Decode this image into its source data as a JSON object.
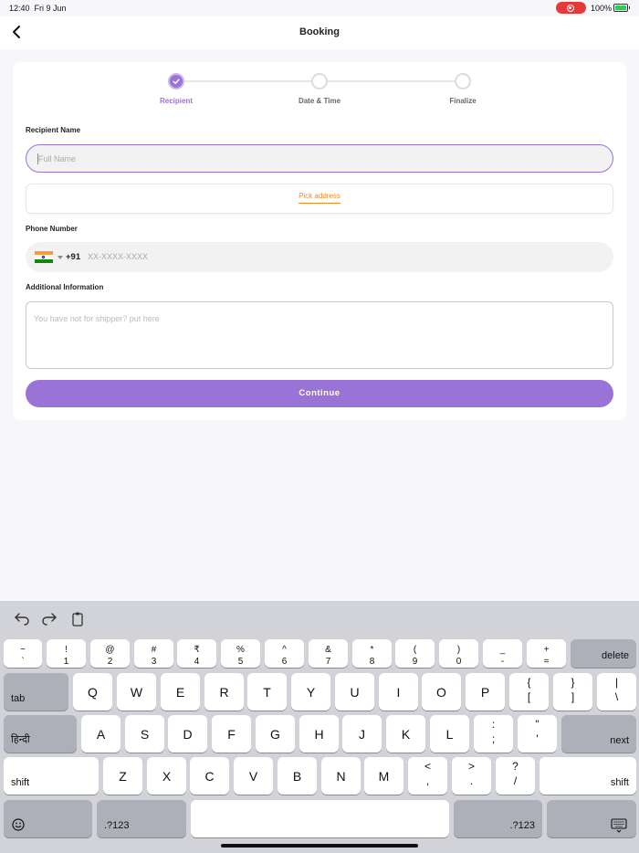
{
  "status_bar": {
    "time": "12:40",
    "date": "Fri 9 Jun",
    "battery": "100%"
  },
  "nav": {
    "title": "Booking"
  },
  "stepper": {
    "steps": [
      "Recipient",
      "Date & Time",
      "Finalize"
    ],
    "current": 1
  },
  "form": {
    "recipient_label": "Recipient Name",
    "name_placeholder": "Full Name",
    "pick_address": "Pick address",
    "phone_label": "Phone Number",
    "dial_code": "+91",
    "phone_placeholder": "XX-XXXX-XXXX",
    "info_label": "Additional Information",
    "info_placeholder": "You have not for shipper? put here",
    "continue": "Continue"
  },
  "colors": {
    "accent": "#9a73d6",
    "link": "#f08a24",
    "record": "#e5393a"
  },
  "keyboard": {
    "row1": [
      {
        "top": "~",
        "bottom": "`"
      },
      {
        "top": "!",
        "bottom": "1"
      },
      {
        "top": "@",
        "bottom": "2"
      },
      {
        "top": "#",
        "bottom": "3"
      },
      {
        "top": "₹",
        "bottom": "4"
      },
      {
        "top": "%",
        "bottom": "5"
      },
      {
        "top": "^",
        "bottom": "6"
      },
      {
        "top": "&",
        "bottom": "7"
      },
      {
        "top": "*",
        "bottom": "8"
      },
      {
        "top": "(",
        "bottom": "9"
      },
      {
        "top": ")",
        "bottom": "0"
      },
      {
        "top": "_",
        "bottom": "-"
      },
      {
        "top": "+",
        "bottom": "="
      }
    ],
    "delete": "delete",
    "tab": "tab",
    "row2": [
      "Q",
      "W",
      "E",
      "R",
      "T",
      "Y",
      "U",
      "I",
      "O",
      "P"
    ],
    "row2_extra": [
      {
        "top": "{",
        "bottom": "["
      },
      {
        "top": "}",
        "bottom": "]"
      },
      {
        "top": "|",
        "bottom": "\\"
      }
    ],
    "lang": "हिन्दी",
    "row3": [
      "A",
      "S",
      "D",
      "F",
      "G",
      "H",
      "J",
      "K",
      "L"
    ],
    "row3_extra": [
      {
        "top": ":",
        "bottom": ";"
      },
      {
        "top": "\"",
        "bottom": "'"
      }
    ],
    "next": "next",
    "shift": "shift",
    "row4": [
      "Z",
      "X",
      "C",
      "V",
      "B",
      "N",
      "M"
    ],
    "row4_extra": [
      {
        "top": "<",
        "bottom": ","
      },
      {
        "top": ">",
        "bottom": "."
      },
      {
        "top": "?",
        "bottom": "/"
      }
    ],
    "numbers": ".?123"
  }
}
